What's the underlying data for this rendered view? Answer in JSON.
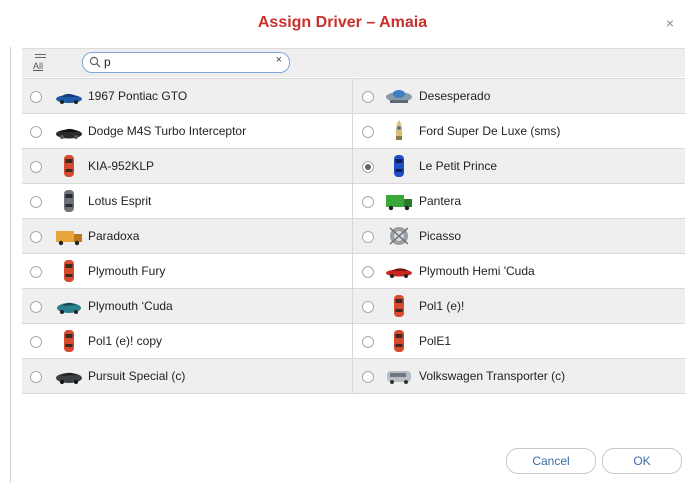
{
  "dialog": {
    "title": "Assign Driver – Amaia",
    "close_label": "×",
    "cancel_label": "Cancel",
    "ok_label": "OK"
  },
  "toolbar": {
    "all_label": "All",
    "search_value": "p",
    "clear_label": "×"
  },
  "vehicles": [
    [
      {
        "name": "1967 Pontiac GTO",
        "icon": "blue-sports-car",
        "selected": false
      },
      {
        "name": "Desesperado",
        "icon": "spaceship",
        "selected": false
      }
    ],
    [
      {
        "name": "Dodge M4S Turbo Interceptor",
        "icon": "black-sports-car",
        "selected": false
      },
      {
        "name": "Ford Super De Luxe (sms)",
        "icon": "rocket",
        "selected": false
      }
    ],
    [
      {
        "name": "KIA-952KLP",
        "icon": "red-car-top",
        "selected": false
      },
      {
        "name": "Le Petit Prince",
        "icon": "blue-car-top",
        "selected": true
      }
    ],
    [
      {
        "name": "Lotus Esprit",
        "icon": "gray-car-top",
        "selected": false
      },
      {
        "name": "Pantera",
        "icon": "green-truck",
        "selected": false
      }
    ],
    [
      {
        "name": "Paradoxa",
        "icon": "orange-truck",
        "selected": false
      },
      {
        "name": "Picasso",
        "icon": "gray-emblem",
        "selected": false
      }
    ],
    [
      {
        "name": "Plymouth Fury",
        "icon": "red-car-top",
        "selected": false
      },
      {
        "name": "Plymouth Hemi 'Cuda",
        "icon": "red-sports-car",
        "selected": false
      }
    ],
    [
      {
        "name": "Plymouth ‘Cuda",
        "icon": "teal-car",
        "selected": false
      },
      {
        "name": "Pol1 (e)!",
        "icon": "red-car-top",
        "selected": false
      }
    ],
    [
      {
        "name": "Pol1 (e)! copy",
        "icon": "red-car-top",
        "selected": false
      },
      {
        "name": "PolE1",
        "icon": "red-car-top",
        "selected": false
      }
    ],
    [
      {
        "name": "Pursuit Special (c)",
        "icon": "dark-sedan",
        "selected": false
      },
      {
        "name": "Volkswagen Transporter (c)",
        "icon": "silver-van",
        "selected": false
      }
    ]
  ],
  "colors": {
    "title": "#c9302c",
    "button_text": "#3a6ea5",
    "search_border": "#7fa7d4"
  }
}
